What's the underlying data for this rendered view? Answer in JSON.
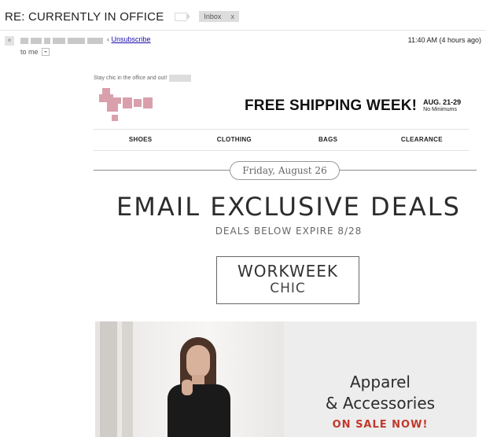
{
  "email": {
    "subject": "RE: CURRENTLY IN OFFICE",
    "label": "Inbox",
    "label_close": "x",
    "unsubscribe": "Unsubscribe",
    "unsubscribe_prefix": "‹",
    "time": "11:40 AM (4 hours ago)",
    "recipient": "to me"
  },
  "newsletter": {
    "preheader": "Stay chic in the office and out!",
    "shipping_banner": "FREE SHIPPING WEEK!",
    "shipping_dates": "AUG. 21-29",
    "shipping_note": "No Minimums",
    "nav": [
      "SHOES",
      "CLOTHING",
      "BAGS",
      "CLEARANCE"
    ],
    "date": "Friday, August 26",
    "headline": "EMAIL EXCLUSIVE DEALS",
    "subheadline": "DEALS BELOW EXPIRE 8/28",
    "feature_top": "WORKWEEK",
    "feature_bottom": "CHIC",
    "hero_title_line1": "Apparel",
    "hero_title_line2": "& Accessories",
    "hero_cta": "ON SALE NOW!"
  },
  "colors": {
    "accent": "#c0392b",
    "logo": "#d9a0ac",
    "panel": "#ededed"
  }
}
